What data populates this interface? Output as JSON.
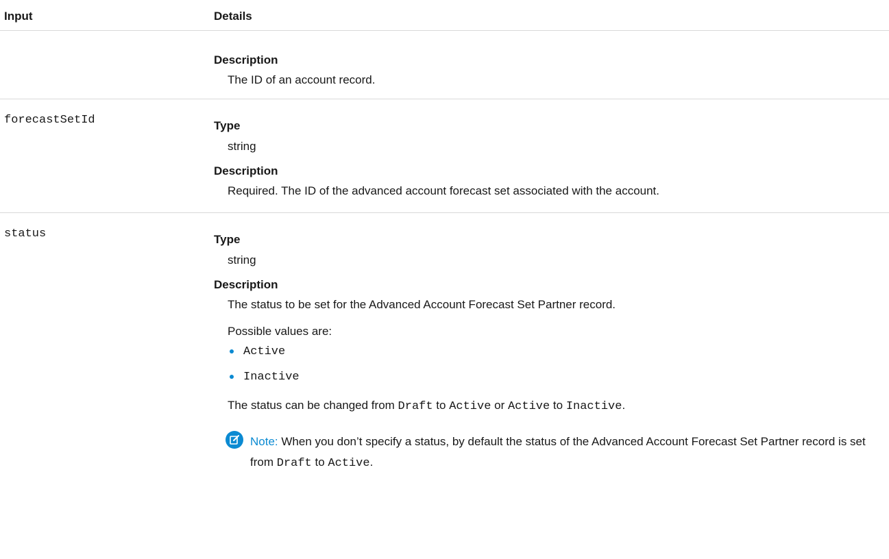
{
  "header": {
    "col_input": "Input",
    "col_details": "Details"
  },
  "row1": {
    "description_label": "Description",
    "description": "The ID of an account record."
  },
  "row2": {
    "param": "forecastSetId",
    "type_label": "Type",
    "type": "string",
    "description_label": "Description",
    "description": "Required. The ID of the advanced account forecast set associated with the account."
  },
  "row3": {
    "param": "status",
    "type_label": "Type",
    "type": "string",
    "description_label": "Description",
    "description": "The status to be set for the Advanced Account Forecast Set Partner record.",
    "possible_values_intro": "Possible values are:",
    "values": [
      "Active",
      "Inactive"
    ],
    "change": {
      "t1": "The status can be changed from ",
      "c1": "Draft",
      "t2": " to ",
      "c2": "Active",
      "t3": " or ",
      "c3": "Active",
      "t4": " to ",
      "c4": "Inactive",
      "t5": "."
    },
    "note": {
      "icon": "note-edit-icon",
      "label": "Note:",
      "t1": "  When you don’t specify a status, by default the status of the Advanced Account Forecast Set Partner record is set from ",
      "c1": "Draft",
      "t2": " to ",
      "c2": "Active",
      "t3": "."
    }
  },
  "colors": {
    "accent": "#0b8ad2",
    "divider": "#d9d9d9",
    "text": "#181818"
  }
}
